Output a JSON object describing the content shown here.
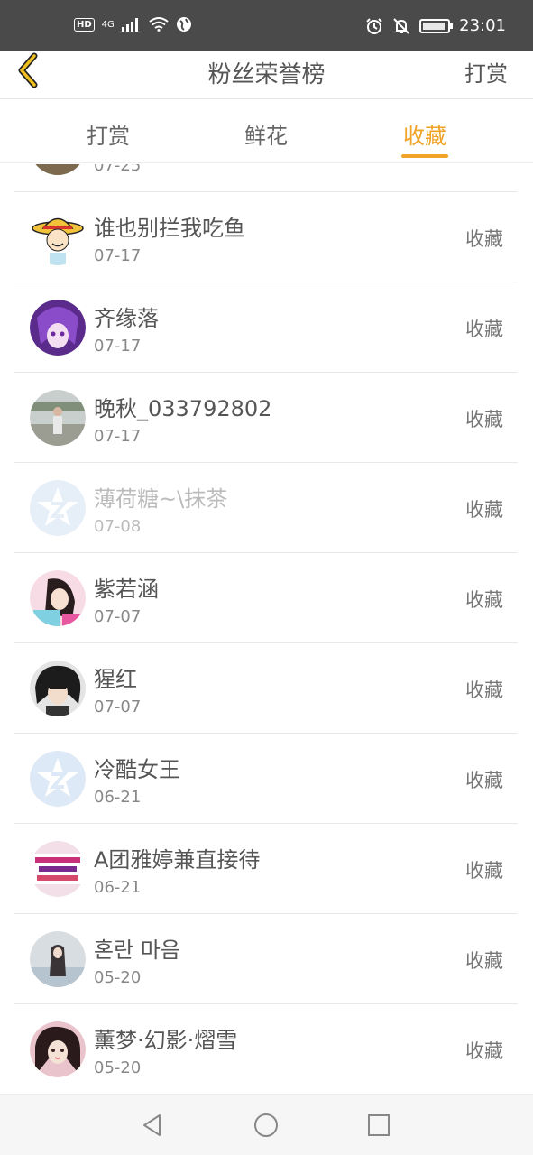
{
  "status_bar": {
    "network": "4G",
    "time": "23:01",
    "hd": "HD"
  },
  "header": {
    "title": "粉丝荣誉榜",
    "action": "打赏"
  },
  "tabs": [
    {
      "label": "打赏",
      "active": false
    },
    {
      "label": "鲜花",
      "active": false
    },
    {
      "label": "收藏",
      "active": true
    }
  ],
  "list": {
    "partial_date": "07-25",
    "items": [
      {
        "name": "谁也别拦我吃鱼",
        "date": "07-17",
        "action": "收藏",
        "faded": false
      },
      {
        "name": "齐缘落",
        "date": "07-17",
        "action": "收藏",
        "faded": false
      },
      {
        "name": "晚秋_033792802",
        "date": "07-17",
        "action": "收藏",
        "faded": false
      },
      {
        "name": "薄荷糖~\\抹茶",
        "date": "07-08",
        "action": "收藏",
        "faded": true
      },
      {
        "name": "紫若涵",
        "date": "07-07",
        "action": "收藏",
        "faded": false
      },
      {
        "name": "猩红",
        "date": "07-07",
        "action": "收藏",
        "faded": false
      },
      {
        "name": "冷酷女王",
        "date": "06-21",
        "action": "收藏",
        "faded": false
      },
      {
        "name": "A团雅婷兼直接待",
        "date": "06-21",
        "action": "收藏",
        "faded": false
      },
      {
        "name": "혼란 마음",
        "date": "05-20",
        "action": "收藏",
        "faded": false
      },
      {
        "name": "薰梦·幻影·熠雪",
        "date": "05-20",
        "action": "收藏",
        "faded": false
      }
    ]
  },
  "colors": {
    "accent": "#f0a326",
    "status_bar": "#4a4a4a"
  },
  "icons": {
    "back": "back-arrow-icon",
    "nav_back": "triangle-back-icon",
    "nav_home": "circle-home-icon",
    "nav_recent": "square-recent-icon"
  }
}
